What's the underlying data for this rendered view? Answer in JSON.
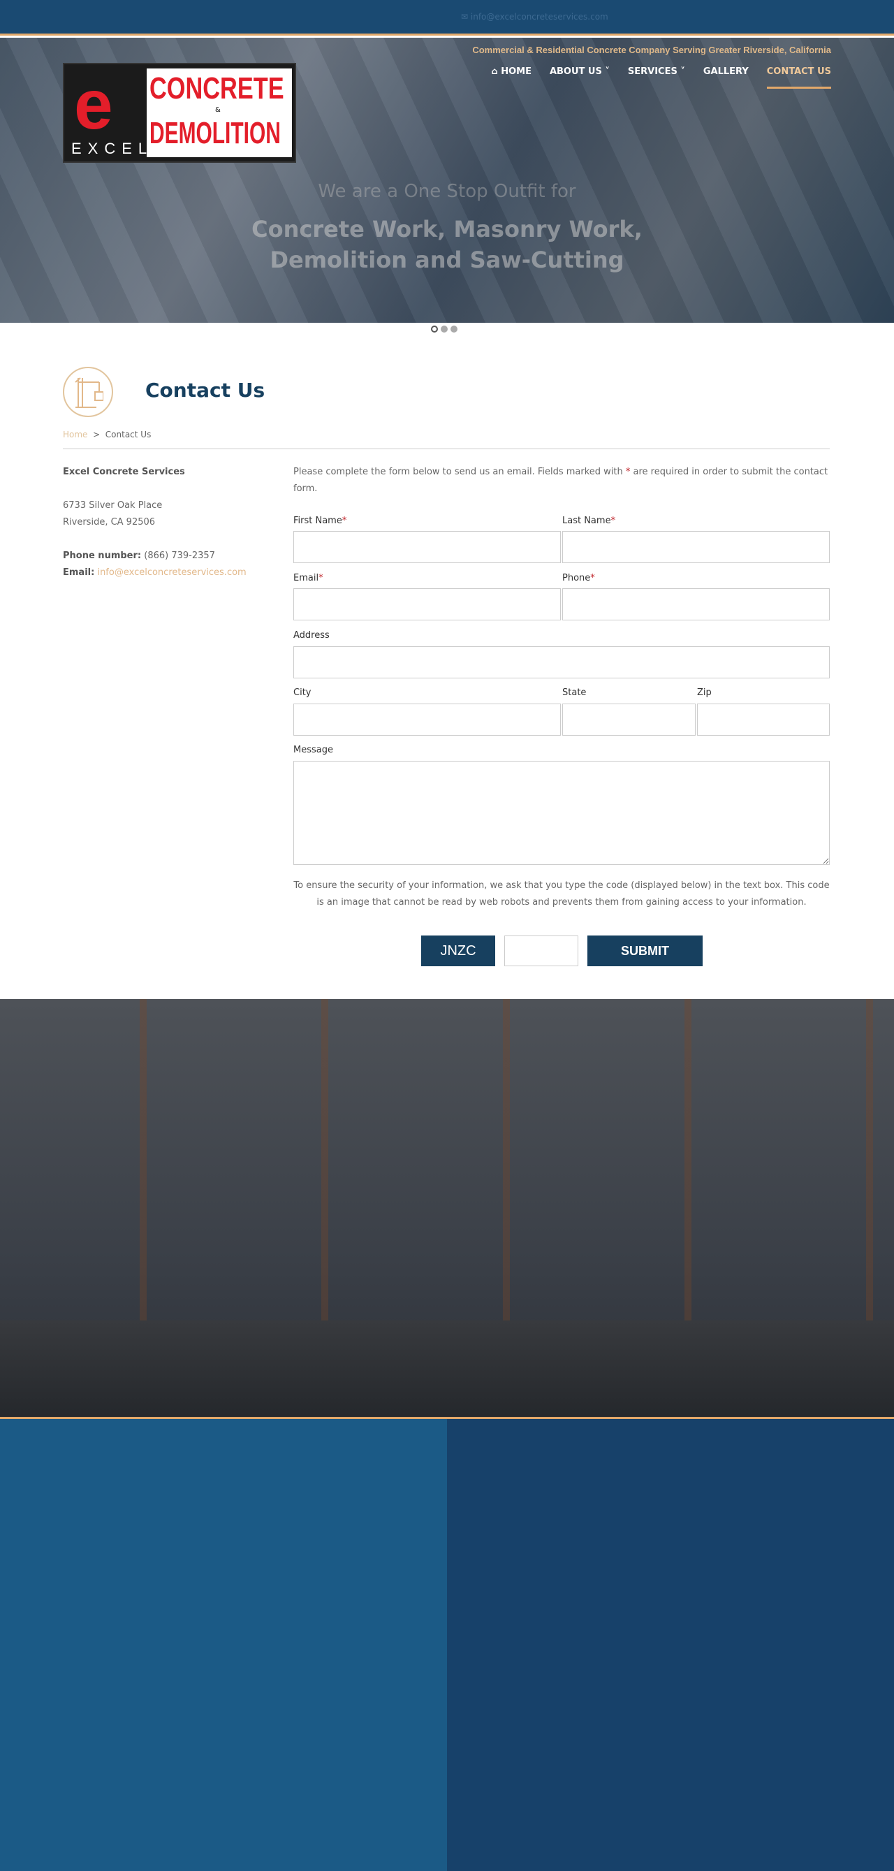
{
  "topbar": {
    "email": "info@excelconcreteservices.com",
    "icon": "envelope-icon"
  },
  "logo": {
    "e": "e",
    "excel": "EXCEL",
    "line1": "CONCRETE",
    "amp": "&",
    "line2": "DEMOLITION"
  },
  "header": {
    "tagline": "Commercial & Residential Concrete Company Serving Greater Riverside, California"
  },
  "nav": [
    {
      "label": "HOME",
      "icon": "home-icon"
    },
    {
      "label": "ABOUT US",
      "dropdown": true
    },
    {
      "label": "SERVICES",
      "dropdown": true
    },
    {
      "label": "GALLERY"
    },
    {
      "label": "CONTACT US",
      "active": true
    }
  ],
  "hero": {
    "line1": "We are a One Stop Outfit for",
    "line2": "Concrete Work, Masonry Work,",
    "line3": "Demolition and Saw-Cutting",
    "slides": 3,
    "active_slide": 1
  },
  "page": {
    "title": "Contact Us",
    "icon": "crane-icon"
  },
  "breadcrumb": {
    "home": "Home",
    "sep": ">",
    "current": "Contact Us"
  },
  "contact": {
    "company": "Excel Concrete Services",
    "address1": "6733 Silver Oak Place",
    "address2": "Riverside, CA 92506",
    "phone_label": "Phone number:",
    "phone": "(866) 739-2357",
    "email_label": "Email:",
    "email": "info@excelconcreteservices.com"
  },
  "form": {
    "intro_a": "Please complete the form below to send us an email. Fields marked with ",
    "intro_star": "*",
    "intro_b": " are required in order to submit the contact form.",
    "first_name": "First Name",
    "last_name": "Last Name",
    "email": "Email",
    "phone": "Phone",
    "address": "Address",
    "city": "City",
    "state": "State",
    "zip": "Zip",
    "message": "Message",
    "star": "*",
    "captcha_text": "To ensure the security of your information, we ask that you type the code (displayed below) in the text box. This code is an image that cannot be read by web robots and prevents them from gaining access to your information.",
    "captcha_code": "JNZC",
    "submit": "SUBMIT"
  },
  "colors": {
    "primary": "#17405f",
    "accent": "#e2a86a",
    "required": "#c0272d"
  }
}
